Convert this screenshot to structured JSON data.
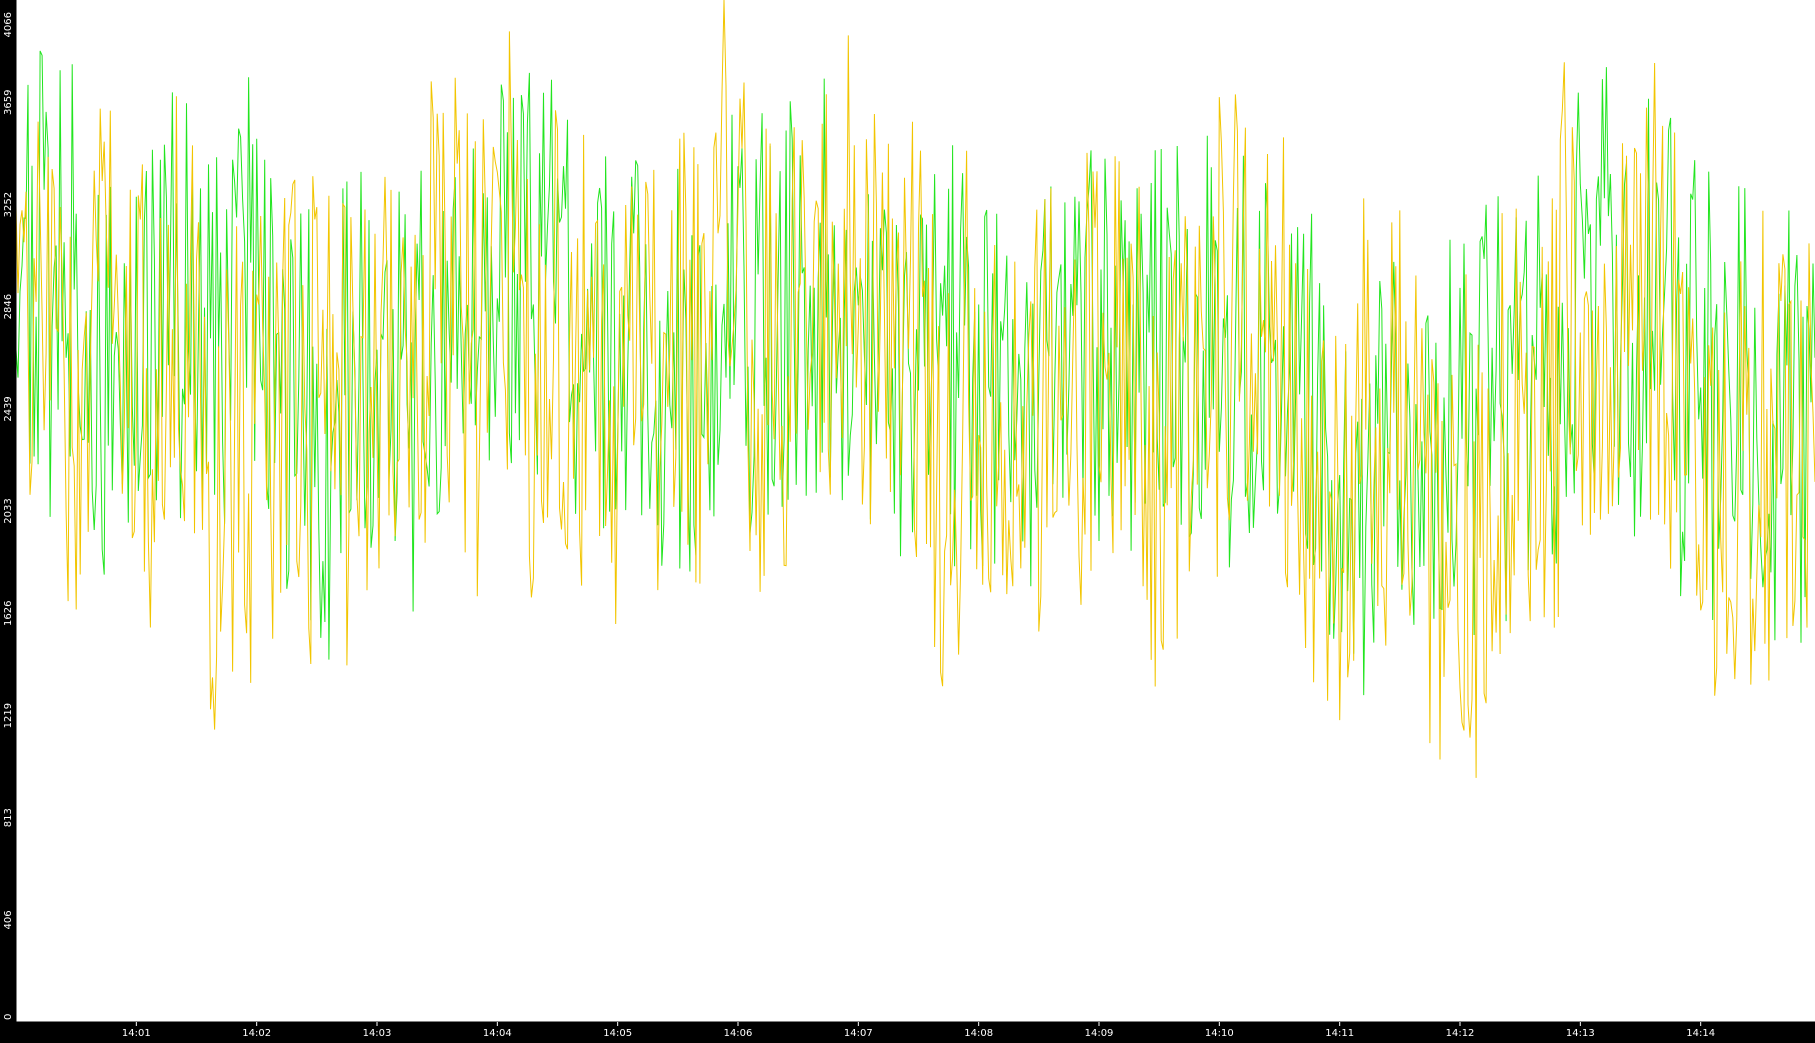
{
  "colors": {
    "background": "#000000",
    "plot_background": "#ffffff",
    "axis": "#000000",
    "tick_text": "#ffffff",
    "series_green": "#22e51f",
    "series_yellow": "#f2c500"
  },
  "chart_data": {
    "type": "line",
    "title": "",
    "xlabel": "",
    "ylabel": "",
    "grid": false,
    "legend": "none",
    "ylim": [
      0,
      4066
    ],
    "y_ticks": [
      "0",
      "406",
      "813",
      "1219",
      "1626",
      "2033",
      "2439",
      "2846",
      "3252",
      "3659",
      "4066"
    ],
    "x_ticks": [
      "14:01",
      "14:02",
      "14:03",
      "14:04",
      "14:05",
      "14:06",
      "14:07",
      "14:08",
      "14:09",
      "14:10",
      "14:11",
      "14:12",
      "14:13",
      "14:14"
    ],
    "x_range_minutes": [
      0,
      14.95
    ],
    "samples_per_minute": 60,
    "series": [
      {
        "color": "#22e51f",
        "keyframes": [
          [
            0,
            2900
          ],
          [
            0.5,
            2700
          ],
          [
            1,
            2800
          ],
          [
            1.5,
            2650
          ],
          [
            2,
            2650
          ],
          [
            2.5,
            2500
          ],
          [
            3,
            2600
          ],
          [
            3.5,
            2650
          ],
          [
            4,
            2900
          ],
          [
            4.5,
            2900
          ],
          [
            5,
            2450
          ],
          [
            5.5,
            2550
          ],
          [
            6,
            2900
          ],
          [
            6.5,
            2950
          ],
          [
            7,
            2800
          ],
          [
            7.5,
            2600
          ],
          [
            8,
            2600
          ],
          [
            8.5,
            2650
          ],
          [
            9,
            2650
          ],
          [
            9.5,
            2650
          ],
          [
            10,
            2700
          ],
          [
            10.5,
            2550
          ],
          [
            11,
            2100
          ],
          [
            11.5,
            2350
          ],
          [
            12,
            2450
          ],
          [
            12.5,
            2350
          ],
          [
            13,
            2800
          ],
          [
            13.5,
            2800
          ],
          [
            14,
            2550
          ],
          [
            14.5,
            2250
          ],
          [
            14.95,
            2450
          ]
        ],
        "amplitude": 1150
      },
      {
        "color": "#f2c500",
        "keyframes": [
          [
            0,
            2950
          ],
          [
            0.5,
            2650
          ],
          [
            1,
            2700
          ],
          [
            1.5,
            2600
          ],
          [
            2,
            2500
          ],
          [
            2.5,
            2450
          ],
          [
            3,
            2450
          ],
          [
            3.5,
            2550
          ],
          [
            4,
            2750
          ],
          [
            4.5,
            2800
          ],
          [
            5,
            2300
          ],
          [
            5.5,
            2400
          ],
          [
            6,
            2800
          ],
          [
            6.5,
            2800
          ],
          [
            7,
            2700
          ],
          [
            7.5,
            2450
          ],
          [
            8,
            2400
          ],
          [
            8.5,
            2500
          ],
          [
            9,
            2500
          ],
          [
            9.5,
            2500
          ],
          [
            10,
            2550
          ],
          [
            10.5,
            2350
          ],
          [
            11,
            1800
          ],
          [
            11.5,
            2150
          ],
          [
            12,
            2250
          ],
          [
            12.5,
            2150
          ],
          [
            13,
            2650
          ],
          [
            13.5,
            2650
          ],
          [
            14,
            2400
          ],
          [
            14.5,
            2050
          ],
          [
            14.95,
            2300
          ]
        ],
        "amplitude": 1350
      }
    ]
  }
}
